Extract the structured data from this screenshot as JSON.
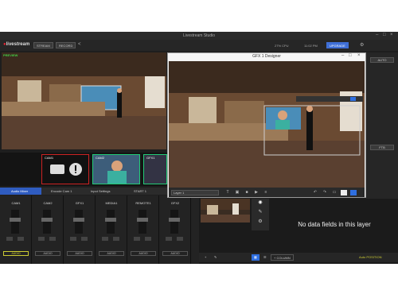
{
  "app": {
    "window_title": "Livestream Studio",
    "logo_text": "livestream",
    "toolbar": {
      "stream_label": "STREAM",
      "record_label": "RECORD",
      "upgrade_label": "UPGRADE",
      "stats": [
        "27% CPU",
        "11:02 PM"
      ]
    }
  },
  "preview": {
    "label": "PREVIEW"
  },
  "inputs": [
    {
      "label": "CAM1"
    },
    {
      "label": "CAM2"
    },
    {
      "label": "GFX1"
    }
  ],
  "channel_tabs": [
    "Audio Mixer",
    "Encode Cam 1",
    "Input Settings",
    "START 1"
  ],
  "mixer": {
    "strips": [
      {
        "name": "CAM1",
        "button": "AUDIO",
        "active": true
      },
      {
        "name": "CAM2",
        "button": "AUDIO",
        "active": false
      },
      {
        "name": "GFX1",
        "button": "AUDIO",
        "active": false
      },
      {
        "name": "MEDIA1",
        "button": "AUDIO",
        "active": false
      },
      {
        "name": "REMOTE1",
        "button": "AUDIO",
        "active": false
      },
      {
        "name": "GFX2",
        "button": "AUDIO",
        "active": false
      }
    ]
  },
  "gfx_designer": {
    "title": "GFX 1 Designer",
    "layer_select_value": "Layer 1",
    "colors": {
      "selected_tool": "#2f6fe0"
    }
  },
  "right_panel": {
    "auto_label": "AUTO",
    "ftb_label": "FTB"
  },
  "layer_panel": {
    "empty_message": "No data fields in this layer",
    "add_column_label": "+ COLUMN",
    "auto_position_label": "Auto POSITION"
  }
}
